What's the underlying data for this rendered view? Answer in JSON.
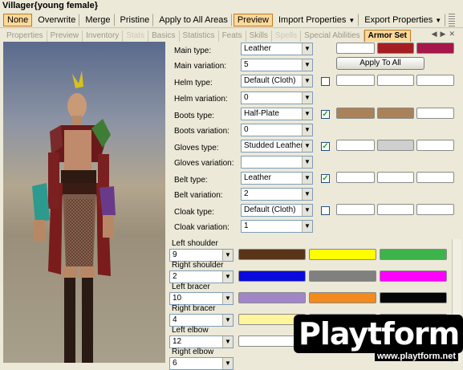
{
  "window": {
    "title": "Villager{young female}"
  },
  "toolbar": {
    "buttons": [
      {
        "label": "None",
        "active": true
      },
      {
        "label": "Overwrite"
      },
      {
        "label": "Merge"
      },
      {
        "label": "Pristine"
      },
      {
        "label": "Apply to All Areas"
      },
      {
        "label": "Preview",
        "active": true
      },
      {
        "label": "Import Properties"
      },
      {
        "label": "Export Properties"
      }
    ]
  },
  "tabs": [
    "Properties",
    "Preview",
    "Inventory",
    "Stats",
    "Basics",
    "Statistics",
    "Feats",
    "Skills",
    "Spells",
    "Special Abilities",
    "Armor Set"
  ],
  "armor": {
    "main_type_label": "Main type:",
    "main_type": "Leather",
    "main_var_label": "Main variation:",
    "main_var": "5",
    "helm_type_label": "Helm type:",
    "helm_type": "Default (Cloth)",
    "helm_var_label": "Helm variation:",
    "helm_var": "0",
    "boots_type_label": "Boots type:",
    "boots_type": "Half-Plate",
    "boots_var_label": "Boots variation:",
    "boots_var": "0",
    "gloves_type_label": "Gloves type:",
    "gloves_type": "Studded Leather",
    "gloves_var_label": "Gloves variation:",
    "gloves_var": "",
    "belt_type_label": "Belt type:",
    "belt_type": "Leather",
    "belt_var_label": "Belt variation:",
    "belt_var": "2",
    "cloak_type_label": "Cloak type:",
    "cloak_type": "Default (Cloth)",
    "cloak_var_label": "Cloak variation:",
    "cloak_var": "1",
    "apply_all": "Apply To All",
    "check_mark": "✓"
  },
  "colors": {
    "main": [
      "#ffffff",
      "#a51e23",
      "#a6174a"
    ],
    "boots": [
      "#a9825a",
      "#a9825a",
      "#ffffff"
    ],
    "gloves": [
      "#ffffff",
      "#cfcfcf",
      "#ffffff"
    ]
  },
  "parts": [
    {
      "label": "Left shoulder",
      "value": "9",
      "colors": [
        "#5a3418",
        "#ffff00",
        "#3cb44b"
      ]
    },
    {
      "label": "Right shoulder",
      "value": "2",
      "colors": [
        "#0a0adc",
        "#808080",
        "#ff00ff"
      ]
    },
    {
      "label": "Left bracer",
      "value": "10",
      "colors": [
        "#9f87c7",
        "#f28a1e",
        "#050505"
      ]
    },
    {
      "label": "Right bracer",
      "value": "4",
      "colors": [
        "#fff59a",
        "#00f5ff",
        "#ffffff"
      ]
    },
    {
      "label": "Left elbow",
      "value": "12",
      "colors": [
        "#ffffff",
        "#ffffff",
        "#ffffff"
      ]
    },
    {
      "label": "Right elbow",
      "value": "6",
      "colors": [
        "#ffffff",
        "#ffffff",
        "#ffffff"
      ]
    }
  ],
  "watermark": {
    "text": "Playtform",
    "url": "www.playtform.net"
  }
}
